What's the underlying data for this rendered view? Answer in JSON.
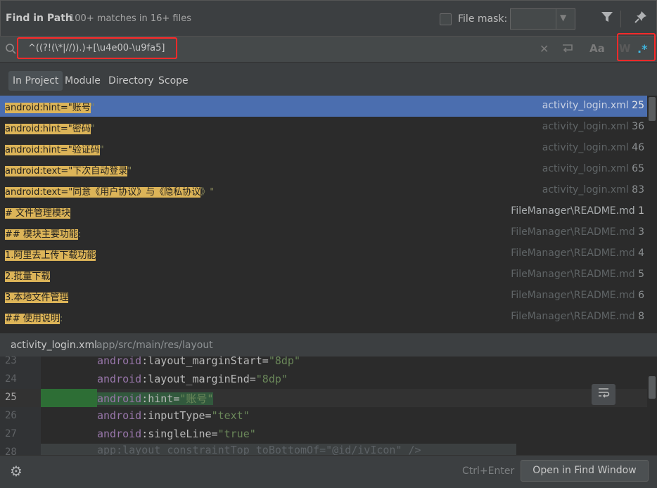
{
  "header": {
    "title": "Find in Path",
    "summary": "100+ matches in 16+ files",
    "file_mask_label": "File mask:",
    "file_mask_value": ""
  },
  "search": {
    "query": "^((?!(\\*|//)).)+[\\u4e00-\\u9fa5]",
    "regex_icon": ".*",
    "match_case_icon": "Aa",
    "words_icon": "W"
  },
  "scopes": [
    "In Project",
    "Module",
    "Directory",
    "Scope"
  ],
  "results": [
    {
      "prefix": "android:hint=\"",
      "match": "账号",
      "suffix": "\"",
      "file": "activity_login.xml",
      "line": "25"
    },
    {
      "prefix": "android:hint=\"",
      "match": "密码",
      "suffix": "\"",
      "file": "activity_login.xml",
      "line": "36"
    },
    {
      "prefix": "android:hint=\"",
      "match": "验证码",
      "suffix": "\"",
      "file": "activity_login.xml",
      "line": "46"
    },
    {
      "prefix": "android:text=\"",
      "match": "下次自动登录",
      "suffix": "\"",
      "file": "activity_login.xml",
      "line": "65"
    },
    {
      "prefix": "android:text=\"",
      "match": "同意《用户协议》与《隐私协议",
      "suffix": "》\"",
      "file": "activity_login.xml",
      "line": "83"
    },
    {
      "prefix": "# ",
      "match": "文件管理模块",
      "suffix": "",
      "file": "FileManager\\README.md",
      "line": "1"
    },
    {
      "prefix": "## ",
      "match": "模块主要功能",
      "suffix": ":",
      "file": "FileManager\\README.md",
      "line": "3"
    },
    {
      "prefix": "1.",
      "match": "阿里去上传下载功能",
      "suffix": "",
      "file": "FileManager\\README.md",
      "line": "4"
    },
    {
      "prefix": "2.",
      "match": "批量下载",
      "suffix": "",
      "file": "FileManager\\README.md",
      "line": "5"
    },
    {
      "prefix": "3.",
      "match": "本地文件管理",
      "suffix": "",
      "file": "FileManager\\README.md",
      "line": "6"
    },
    {
      "prefix": "## ",
      "match": "使用说明",
      "suffix": ":",
      "file": "FileManager\\README.md",
      "line": "8"
    }
  ],
  "preview": {
    "file": "activity_login.xml",
    "path": "app/src/main/res/layout",
    "lines": [
      {
        "num": "23",
        "ns": "android",
        "attr": ":layout_marginStart=",
        "val": "\"8dp\""
      },
      {
        "num": "24",
        "ns": "android",
        "attr": ":layout_marginEnd=",
        "val": "\"8dp\""
      },
      {
        "num": "25",
        "ns": "android",
        "attr": ":hint=",
        "val": "\"账号\""
      },
      {
        "num": "26",
        "ns": "android",
        "attr": ":inputType=",
        "val": "\"text\""
      },
      {
        "num": "27",
        "ns": "android",
        "attr": ":singleLine=",
        "val": "\"true\""
      },
      {
        "num": "28",
        "ns": "app",
        "attr": ":layout_constraintTop_toBottomOf=",
        "val": "\"@id/ivIcon\" />"
      }
    ]
  },
  "footer": {
    "shortcut": "Ctrl+Enter",
    "open_button": "Open in Find Window"
  }
}
